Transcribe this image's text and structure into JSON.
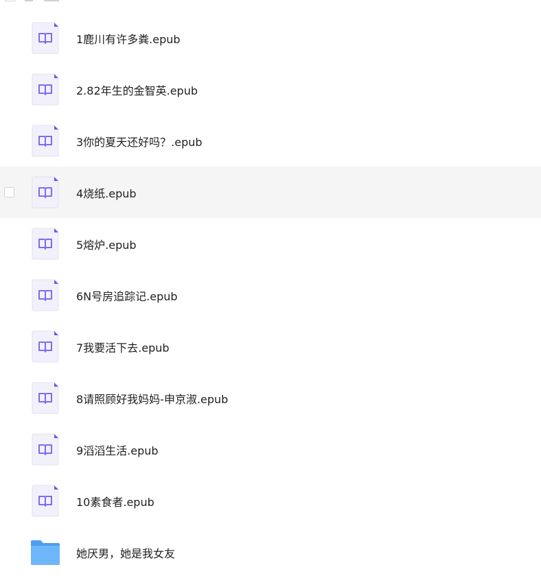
{
  "files": [
    {
      "name": "1鹿川有许多粪.epub",
      "type": "epub"
    },
    {
      "name": "2.82年生的金智英.epub",
      "type": "epub"
    },
    {
      "name": "3你的夏天还好吗？.epub",
      "type": "epub"
    },
    {
      "name": "4烧纸.epub",
      "type": "epub",
      "hovered": true
    },
    {
      "name": "5熔炉.epub",
      "type": "epub"
    },
    {
      "name": "6N号房追踪记.epub",
      "type": "epub"
    },
    {
      "name": "7我要活下去.epub",
      "type": "epub"
    },
    {
      "name": "8请照顾好我妈妈-申京淑.epub",
      "type": "epub"
    },
    {
      "name": "9滔滔生活.epub",
      "type": "epub"
    },
    {
      "name": "10素食者.epub",
      "type": "epub"
    },
    {
      "name": "她厌男，她是我女友",
      "type": "folder"
    }
  ],
  "colors": {
    "epub_accent": "#7b6cf0",
    "epub_bg": "#f1f0fb",
    "folder": "#5aa9f5",
    "row_hover": "#f5f5f5"
  },
  "icons": {
    "epub": "book-icon",
    "folder": "folder-icon"
  }
}
